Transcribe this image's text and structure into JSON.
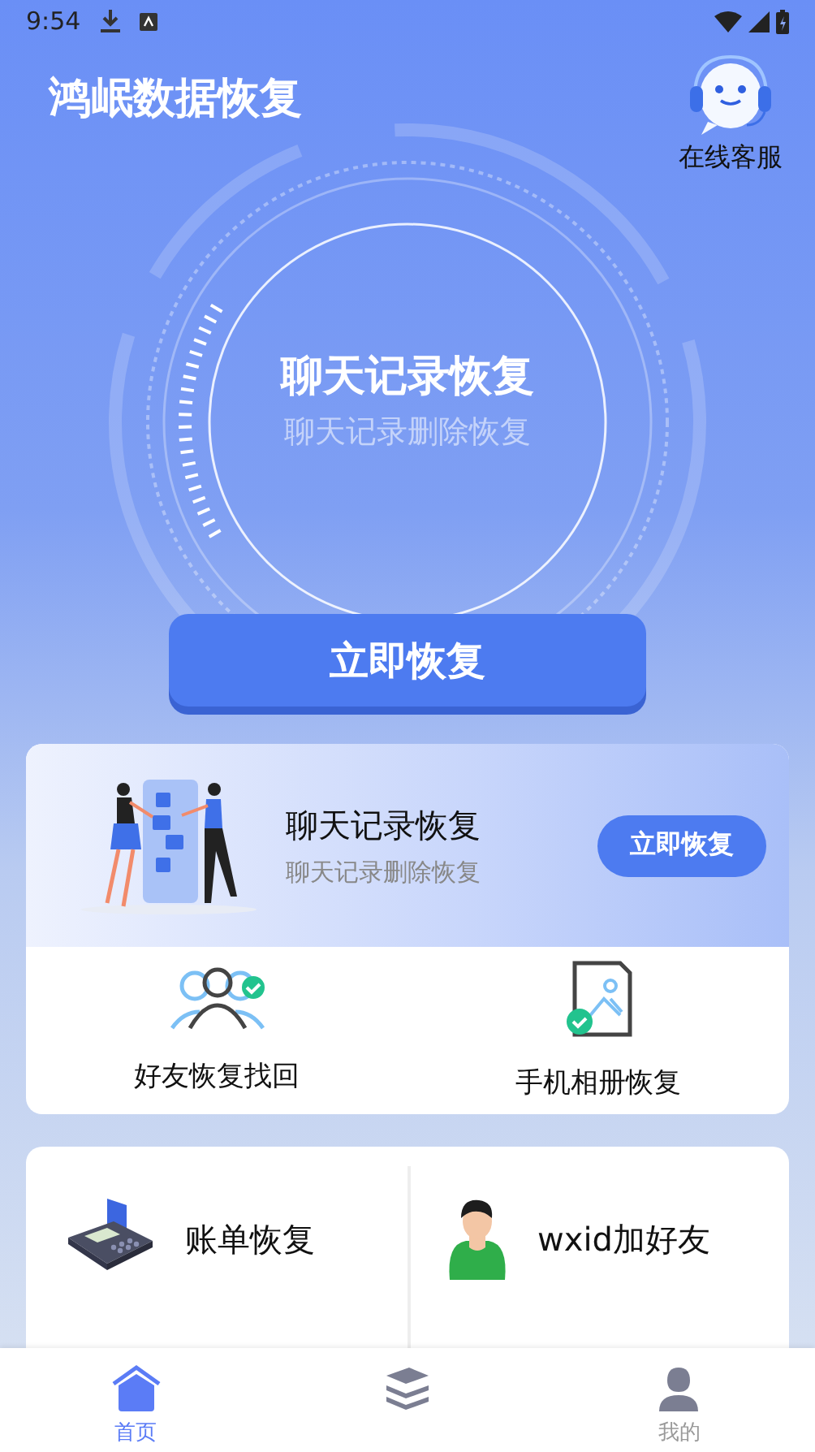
{
  "status_bar": {
    "time": "9:54"
  },
  "app_title": "鸿岷数据恢复",
  "support": {
    "label": "在线客服"
  },
  "hero": {
    "title": "聊天记录恢复",
    "subtitle": "聊天记录删除恢复",
    "button": "立即恢复"
  },
  "feature_card": {
    "title": "聊天记录恢复",
    "subtitle": "聊天记录删除恢复",
    "button": "立即恢复"
  },
  "tools": [
    {
      "kind": "friends",
      "label": "好友恢复找回"
    },
    {
      "kind": "album",
      "label": "手机相册恢复"
    }
  ],
  "shortcuts": [
    {
      "kind": "bill",
      "label": "账单恢复"
    },
    {
      "kind": "contact",
      "label": "wxid加好友"
    }
  ],
  "nav": [
    {
      "kind": "home",
      "label": "首页",
      "selected": true
    },
    {
      "kind": "stack",
      "selected": false
    },
    {
      "kind": "user",
      "label": "我的",
      "selected": false
    }
  ]
}
